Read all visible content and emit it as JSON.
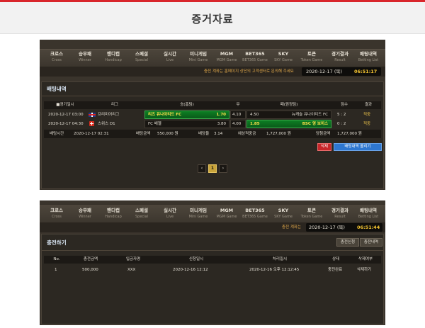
{
  "page": {
    "title": "증거자료"
  },
  "nav": [
    {
      "ko": "크로스",
      "en": "Cross"
    },
    {
      "ko": "승무패",
      "en": "Winner"
    },
    {
      "ko": "핸디캡",
      "en": "Handicap"
    },
    {
      "ko": "스페셜",
      "en": "Special"
    },
    {
      "ko": "실시간",
      "en": "Live"
    },
    {
      "ko": "미니게임",
      "en": "Mini Game"
    },
    {
      "ko": "MGM",
      "en": "MGM Game"
    },
    {
      "ko": "BET365",
      "en": "BET365 Game"
    },
    {
      "ko": "SKY",
      "en": "SKY Game"
    },
    {
      "ko": "토큰",
      "en": "Token Game"
    },
    {
      "ko": "경기결과",
      "en": "Result"
    },
    {
      "ko": "배팅내역",
      "en": "Betting List"
    }
  ],
  "shot1": {
    "ticker": "충전 계좌는 홈페이지 상단의 고객센터로 문의해 주세요",
    "clock": {
      "date": "2020-12-17 (목)",
      "time": "06:51:17"
    },
    "panel_title": "배팅내역",
    "headers": [
      "■경기일시",
      "리그",
      "승(홈팀)",
      "무",
      "패(원정팀)",
      "점수",
      "결과"
    ],
    "rows": [
      {
        "date": "2020-12-17 03:00",
        "league": "프리미어리그",
        "home": "리즈 유나이티드 FC",
        "home_odds": "1.70",
        "draw": "4.10",
        "away_odds": "4.50",
        "away": "뉴캐슬 유나이티드 FC",
        "score": "5 : 2",
        "result": "적중"
      },
      {
        "date": "2020-12-17 04:30",
        "league": "스위스 D1",
        "home": "FC 베젤",
        "home_odds": "3.80",
        "draw": "4.00",
        "away_odds": "1.85",
        "away": "BSC 영 보이스",
        "score": "0 : 2",
        "result": "적중"
      }
    ],
    "summary": {
      "bet_time_label": "배팅시간",
      "bet_time": "2020-12-17 02:31",
      "amount_label": "배팅금액",
      "amount": "550,000 원",
      "odds_label": "배당율",
      "odds": "3.14",
      "expected_label": "예상적중금",
      "expected": "1,727,000 원",
      "win_label": "당첨금액",
      "win": "1,727,000 원"
    },
    "buttons": {
      "delete": "삭제",
      "upload": "배팅내역 올리기"
    },
    "pagination": {
      "prev": "‹",
      "current": "1",
      "next": "›"
    }
  },
  "shot2": {
    "ticker": "충전 계좌는",
    "clock": {
      "date": "2020-12-17 (목)",
      "time": "06:51:44"
    },
    "panel_title": "충전하기",
    "buttons": {
      "apply": "충전신청",
      "history": "충전내역"
    },
    "headers": [
      "No.",
      "충전금액",
      "입금자명",
      "신청일시",
      "처리일시",
      "상태",
      "삭제여부"
    ],
    "row": {
      "no": "1",
      "amount": "500,000",
      "name": "XXX",
      "applied": "2020-12-16 12:12",
      "processed": "2020-12-16 오후 12:12:45",
      "status": "충전완료",
      "delete": "삭제하기"
    }
  },
  "colors": {
    "accent_red": "#d9262b",
    "gold": "#f2c230",
    "bet_green": "#0d7f24",
    "button_blue": "#2e77d0"
  }
}
